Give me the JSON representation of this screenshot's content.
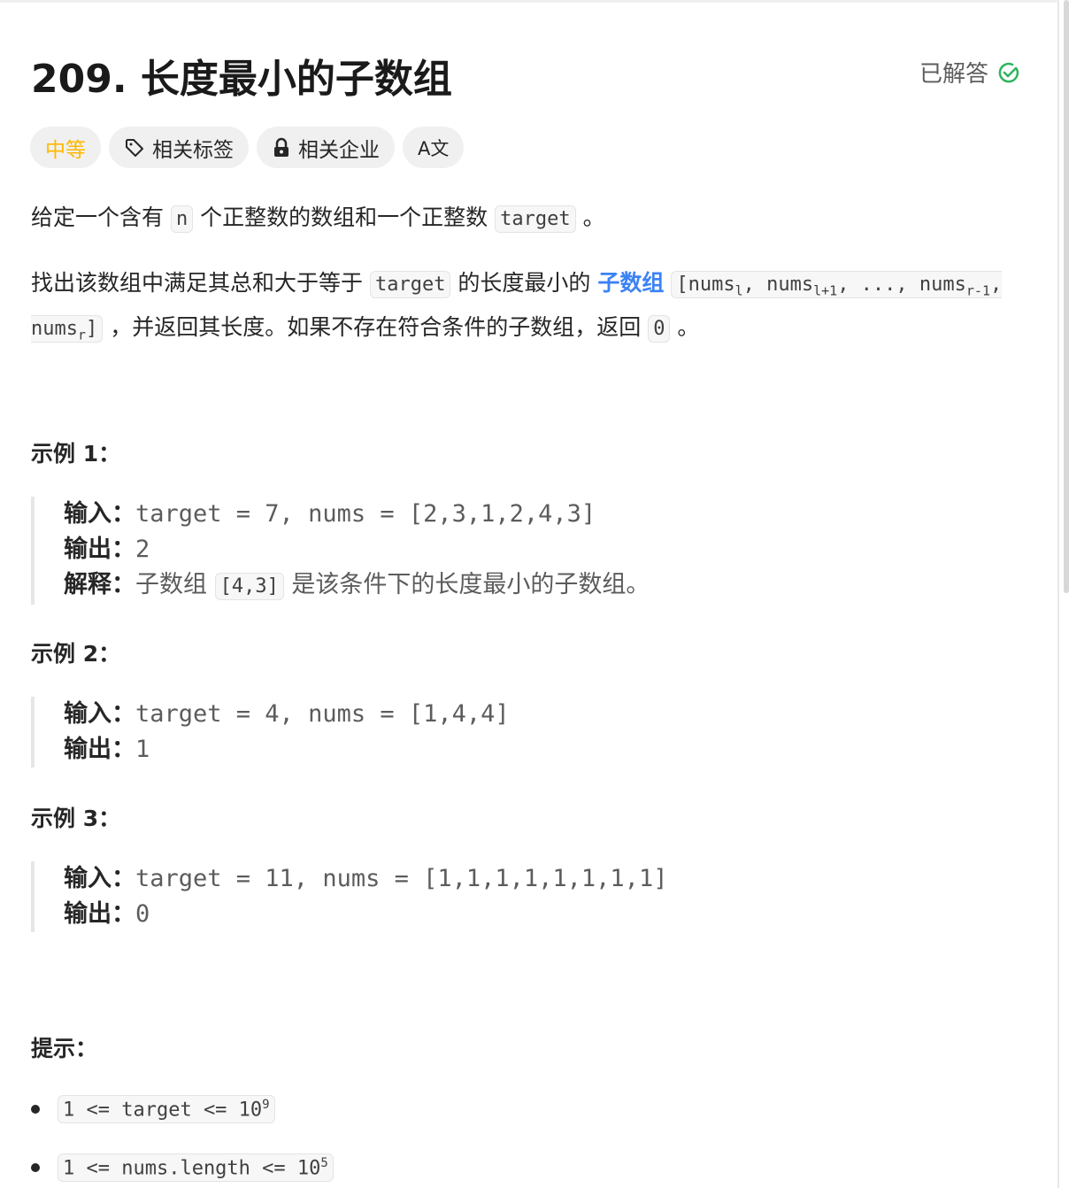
{
  "title": "209. 长度最小的子数组",
  "status": "已解答",
  "tags": {
    "difficulty": "中等",
    "topics": "相关标签",
    "companies": "相关企业",
    "translate": "A文"
  },
  "desc1": {
    "a": "给定一个含有",
    "code1": "n",
    "b": "个正整数的数组和一个正整数",
    "code2": "target",
    "c": "。"
  },
  "desc2": {
    "a": "找出该数组中满足其总和大于等于",
    "code1": "target",
    "b": "的长度最小的",
    "link": "子数组",
    "code2a": "[nums",
    "sub1": "l",
    "code2b": ", nums",
    "sub2": "l+1",
    "code2c": ", ..., nums",
    "sub3": "r-1",
    "code2d": ", nums",
    "sub4": "r",
    "code2e": "]",
    "c": "，并返回其长度。如果不存在符合条件的子数组，返回",
    "code3": "0",
    "d": "。"
  },
  "examples": [
    {
      "heading": "示例 1：",
      "input_label": "输入：",
      "input": "target = 7, nums = [2,3,1,2,4,3]",
      "output_label": "输出：",
      "output": "2",
      "explain_label": "解释：",
      "explain_a": "子数组",
      "explain_code": "[4,3]",
      "explain_b": "是该条件下的长度最小的子数组。"
    },
    {
      "heading": "示例 2：",
      "input_label": "输入：",
      "input": "target = 4, nums = [1,4,4]",
      "output_label": "输出：",
      "output": "1"
    },
    {
      "heading": "示例 3：",
      "input_label": "输入：",
      "input": "target = 11, nums = [1,1,1,1,1,1,1,1]",
      "output_label": "输出：",
      "output": "0"
    }
  ],
  "hints": {
    "heading": "提示：",
    "items": [
      {
        "base": "1 <= target <= 10",
        "exp": "9"
      },
      {
        "base": "1 <= nums.length <= 10",
        "exp": "5"
      }
    ]
  },
  "colors": {
    "difficulty": "#ffb800",
    "link": "#3b82f6",
    "solved": "#2db55d"
  }
}
